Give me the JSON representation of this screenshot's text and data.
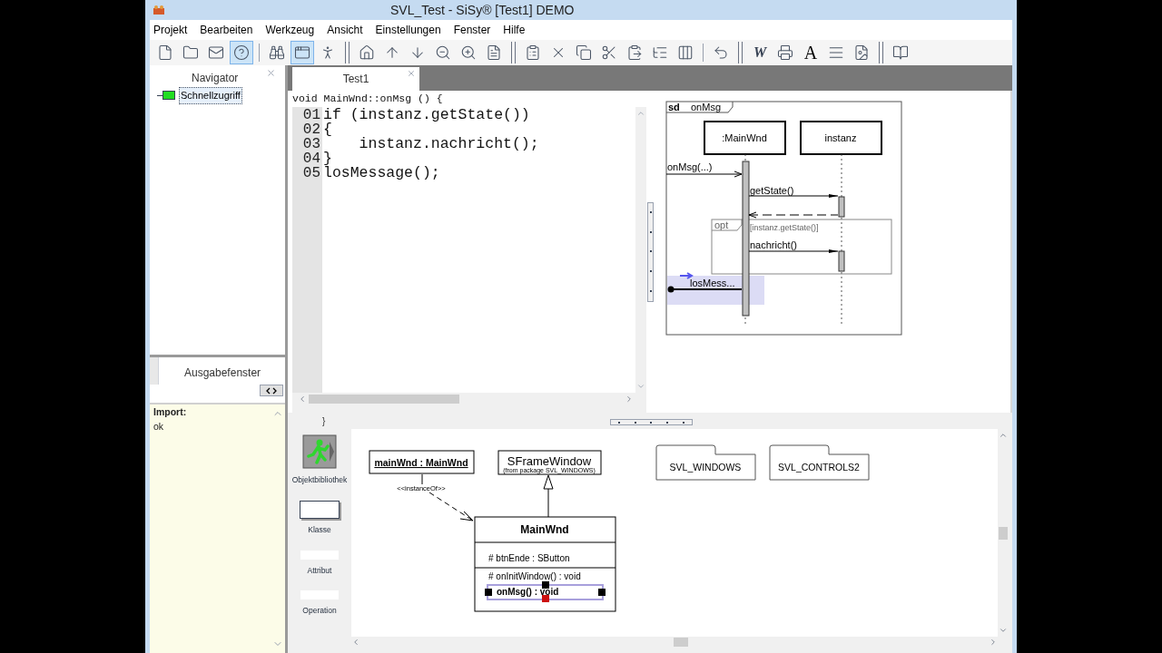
{
  "window": {
    "title": "SVL_Test - SiSy® [Test1] DEMO"
  },
  "menu": [
    "Projekt",
    "Bearbeiten",
    "Werkzeug",
    "Ansicht",
    "Einstellungen",
    "Fenster",
    "Hilfe"
  ],
  "toolbar": [
    {
      "kind": "file",
      "pressed": false
    },
    {
      "kind": "folder",
      "pressed": false
    },
    {
      "kind": "mail",
      "pressed": false
    },
    {
      "kind": "help",
      "pressed": true
    },
    {
      "kind": "separator"
    },
    {
      "kind": "binoculars",
      "pressed": false
    },
    {
      "kind": "window",
      "pressed": true
    },
    {
      "kind": "person",
      "pressed": false
    },
    {
      "kind": "double-separator"
    },
    {
      "kind": "home",
      "pressed": false
    },
    {
      "kind": "up",
      "pressed": false
    },
    {
      "kind": "down",
      "pressed": false
    },
    {
      "kind": "zoom-out",
      "pressed": false
    },
    {
      "kind": "zoom-in",
      "pressed": false
    },
    {
      "kind": "document",
      "pressed": false
    },
    {
      "kind": "double-separator"
    },
    {
      "kind": "clipboard",
      "pressed": false
    },
    {
      "kind": "cross",
      "pressed": false
    },
    {
      "kind": "copy",
      "pressed": false
    },
    {
      "kind": "scissors",
      "pressed": false
    },
    {
      "kind": "paste",
      "pressed": false
    },
    {
      "kind": "tree",
      "pressed": false
    },
    {
      "kind": "columns",
      "pressed": false
    },
    {
      "kind": "separator"
    },
    {
      "kind": "undo",
      "pressed": false
    },
    {
      "kind": "double-separator"
    },
    {
      "kind": "bold-letter",
      "label": "W",
      "pressed": false
    },
    {
      "kind": "printer",
      "pressed": false
    },
    {
      "kind": "serif-letter",
      "label": "A",
      "pressed": false
    },
    {
      "kind": "lines",
      "pressed": false
    },
    {
      "kind": "image",
      "pressed": false
    },
    {
      "kind": "double-separator"
    },
    {
      "kind": "book",
      "pressed": false
    }
  ],
  "navigator": {
    "title": "Navigator",
    "items": [
      {
        "label": "Schnellzugriff",
        "selected": true
      }
    ]
  },
  "output": {
    "tab": "Ausgabefenster",
    "heading": "Import:",
    "text": "ok"
  },
  "editor": {
    "tabs": [
      {
        "label": "Test1",
        "selected": true
      }
    ],
    "header": "void MainWnd::onMsg () {",
    "lines": [
      {
        "number": "01",
        "code": "if (instanz.getState())"
      },
      {
        "number": "02",
        "code": "{"
      },
      {
        "number": "03",
        "code": "    instanz.nachricht();"
      },
      {
        "number": "04",
        "code": "}"
      },
      {
        "number": "05",
        "code": "losMessage();"
      }
    ],
    "footer": "}"
  },
  "sequence_diagram": {
    "keyword": "sd",
    "name": "onMsg",
    "lifelines": [
      ":MainWnd",
      "instanz"
    ],
    "incoming": "onMsg(...)",
    "call": "getState()",
    "fragment": "opt",
    "guard": "[instanz.getState()]",
    "fragment_call": "nachricht()",
    "outgoing": "losMess..."
  },
  "palette": [
    {
      "kind": "library",
      "label": "Objektbibliothek"
    },
    {
      "kind": "class",
      "label": "Klasse"
    },
    {
      "kind": "flat",
      "label": "Attribut"
    },
    {
      "kind": "flat",
      "label": "Operation"
    }
  ],
  "class_diagram": {
    "object": "mainWnd : MainWnd",
    "superclass": "SFrameWindow",
    "superclass_note": "(from package SVL_WINDOWS)",
    "dependency": "<<instanceOf>>",
    "class": {
      "name": "MainWnd",
      "attributes": [
        "# btnEnde : SButton"
      ],
      "operations": [
        {
          "label": "# onInitWindow() : void",
          "selected": false
        },
        {
          "label": "onMsg() : void",
          "selected": true
        }
      ]
    },
    "packages": [
      "SVL_WINDOWS",
      "SVL_CONTROLS2"
    ]
  }
}
